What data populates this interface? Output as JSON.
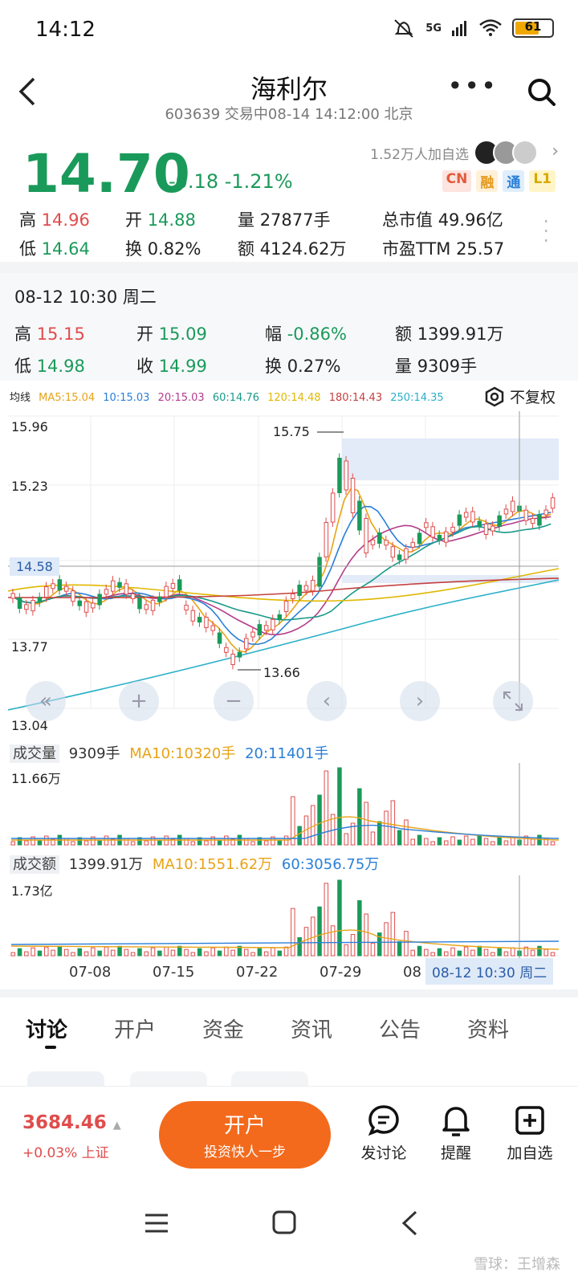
{
  "status": {
    "time": "14:12",
    "network": "5G",
    "battery": "61"
  },
  "header": {
    "title": "海利尔",
    "subtitle": "603639 交易中08-14 14:12:00 北京"
  },
  "quote": {
    "price": "14.70",
    "change": "-0.18 -1.21%",
    "watch_count": "1.52万人加自选",
    "tags": [
      "CN",
      "融",
      "通",
      "L1"
    ],
    "high_label": "高",
    "high": "14.96",
    "low_label": "低",
    "low": "14.64",
    "open_label": "开",
    "open": "14.88",
    "turnover_label": "换",
    "turnover": "0.82%",
    "volume_label": "量",
    "volume": "27877手",
    "amount_label": "额",
    "amount": "4124.62万",
    "mktcap_label": "总市值",
    "mktcap": "49.96亿",
    "pe_label": "市盈TTM",
    "pe": "25.57"
  },
  "day_detail": {
    "title": "08-12 10:30 周二",
    "high_label": "高",
    "high": "15.15",
    "low_label": "低",
    "low": "14.98",
    "open_label": "开",
    "open": "15.09",
    "close_label": "收",
    "close": "14.99",
    "range_label": "幅",
    "range": "-0.86%",
    "turnover_label": "换",
    "turnover": "0.27%",
    "amount_label": "额",
    "amount": "1399.91万",
    "volume_label": "量",
    "volume": "9309手"
  },
  "ma_legend": {
    "label": "均线",
    "items": [
      {
        "text": "MA5:15.04",
        "color": "#e8a317"
      },
      {
        "text": "10:15.03",
        "color": "#2a7fd8"
      },
      {
        "text": "20:15.03",
        "color": "#b43c8c"
      },
      {
        "text": "60:14.76",
        "color": "#1a9a8a"
      },
      {
        "text": "120:14.48",
        "color": "#e0b800"
      },
      {
        "text": "180:14.43",
        "color": "#c44040"
      },
      {
        "text": "250:14.35",
        "color": "#2ab0c8"
      }
    ],
    "fuquan": "不复权"
  },
  "kline": {
    "y_ticks": [
      "15.96",
      "15.23",
      "14.58",
      "13.77",
      "13.04"
    ],
    "max_label": "15.75",
    "min_label": "13.66"
  },
  "volume_panel": {
    "label": "成交量",
    "value": "9309手",
    "ma10": "MA10:10320手",
    "ma20": "20:11401手",
    "max": "11.66万"
  },
  "amount_panel": {
    "label": "成交额",
    "value": "1399.91万",
    "ma10": "MA10:1551.62万",
    "ma60": "60:3056.75万",
    "max": "1.73亿"
  },
  "x_ticks": [
    "07-08",
    "07-15",
    "07-22",
    "07-29",
    "08"
  ],
  "cursor_date": "08-12 10:30 周二",
  "tabs": [
    "讨论",
    "开户",
    "资金",
    "资讯",
    "公告",
    "资料"
  ],
  "bottom": {
    "index_value": "3684.46",
    "index_change": "+0.03% 上证",
    "open_account": "开户",
    "open_account_sub": "投资快人一步",
    "post": "发讨论",
    "remind": "提醒",
    "add_watch": "加自选"
  },
  "watermark": "雪球：王增森"
}
